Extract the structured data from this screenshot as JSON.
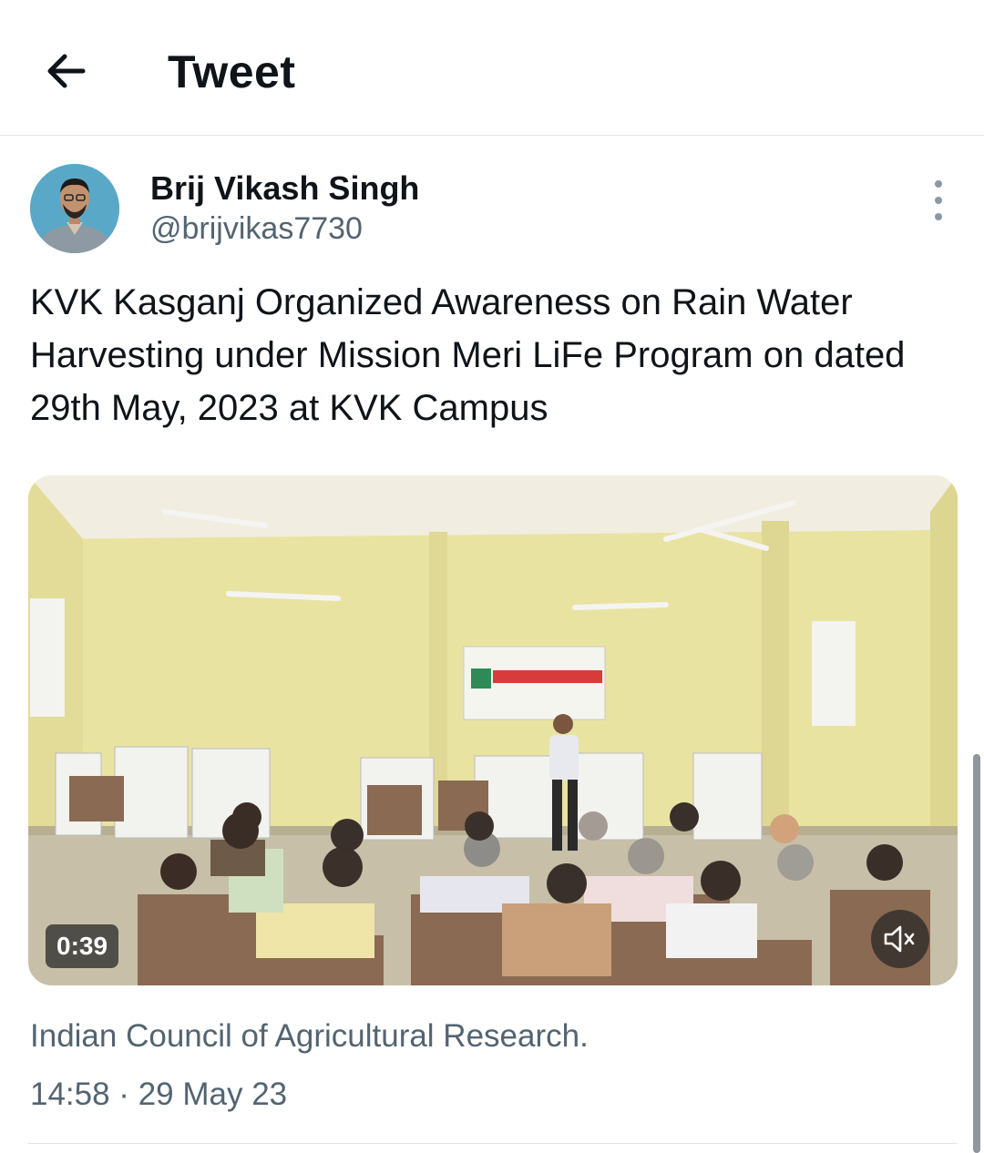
{
  "header": {
    "title": "Tweet",
    "back_icon": "arrow-left-icon"
  },
  "author": {
    "name": "Brij Vikash Singh",
    "handle": "@brijvikas7730",
    "avatar_bg": "#63aecb"
  },
  "tweet": {
    "text": "KVK Kasganj Organized Awareness on Rain Water Harvesting under Mission Meri LiFe Program on dated 29th May, 2023 at KVK Campus",
    "video": {
      "duration": "0:39",
      "mute_icon": "speaker-muted-icon"
    },
    "source": "Indian Council of Agricultural Research.",
    "timestamp": "14:58 · 29 May 23"
  },
  "colors": {
    "text_primary": "#0f1419",
    "text_secondary": "#536471",
    "divider": "#e1e5e8"
  }
}
